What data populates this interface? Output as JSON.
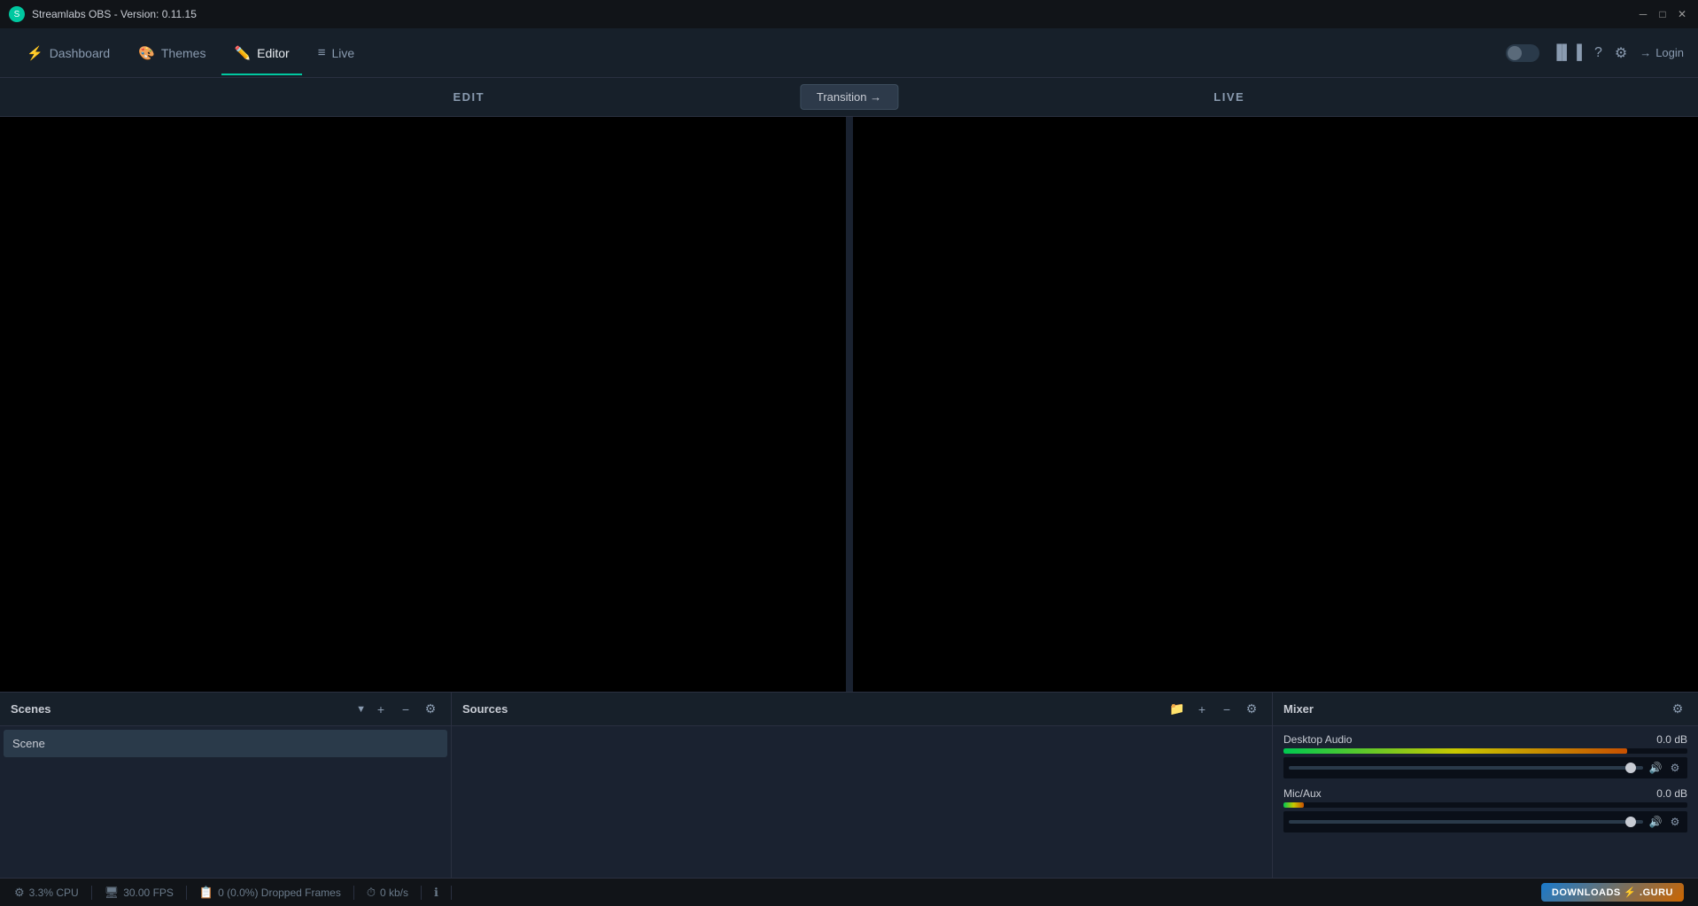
{
  "titleBar": {
    "appName": "Streamlabs OBS - Version: 0.11.15",
    "windowControls": {
      "minimize": "─",
      "maximize": "□",
      "close": "✕"
    }
  },
  "nav": {
    "items": [
      {
        "id": "dashboard",
        "label": "Dashboard",
        "icon": "⚡"
      },
      {
        "id": "themes",
        "label": "Themes",
        "icon": "🎨"
      },
      {
        "id": "editor",
        "label": "Editor",
        "icon": "✏️",
        "active": true
      },
      {
        "id": "live",
        "label": "Live",
        "icon": "≡"
      }
    ],
    "right": {
      "toggleLabel": "",
      "barChartIcon": "▌▌▌",
      "helpIcon": "?",
      "settingsIcon": "⚙",
      "loginIcon": "→",
      "loginLabel": "Login"
    }
  },
  "studioMode": {
    "editLabel": "EDIT",
    "liveLabel": "LIVE",
    "transitionButton": "Transition →"
  },
  "scenes": {
    "title": "Scenes",
    "items": [
      {
        "name": "Scene",
        "active": true
      }
    ],
    "actions": {
      "add": "+",
      "remove": "−",
      "settings": "⚙"
    }
  },
  "sources": {
    "title": "Sources",
    "items": [],
    "actions": {
      "folder": "📁",
      "add": "+",
      "remove": "−",
      "settings": "⚙"
    }
  },
  "mixer": {
    "title": "Mixer",
    "settingsIcon": "⚙",
    "tracks": [
      {
        "name": "Desktop Audio",
        "db": "0.0 dB",
        "meterWidth": 85,
        "sliderPosition": 88
      },
      {
        "name": "Mic/Aux",
        "db": "0.0 dB",
        "meterWidth": 5,
        "sliderPosition": 88
      }
    ]
  },
  "statusBar": {
    "items": [
      {
        "icon": "⚙",
        "text": "3.3% CPU"
      },
      {
        "icon": "🖥",
        "text": "30.00 FPS"
      },
      {
        "icon": "📋",
        "text": "0 (0.0%) Dropped Frames"
      },
      {
        "icon": "⏱",
        "text": "0 kb/s"
      },
      {
        "icon": "ℹ"
      }
    ],
    "guroBanner": "DOWNLOADS ⚡ .GURU"
  },
  "colors": {
    "accent": "#00c8a0",
    "bg_dark": "#111418",
    "bg_mid": "#17202a",
    "bg_panel": "#1a2230",
    "border": "#2a3040",
    "text_primary": "#c8ccd4",
    "text_muted": "#8a9bb0"
  }
}
